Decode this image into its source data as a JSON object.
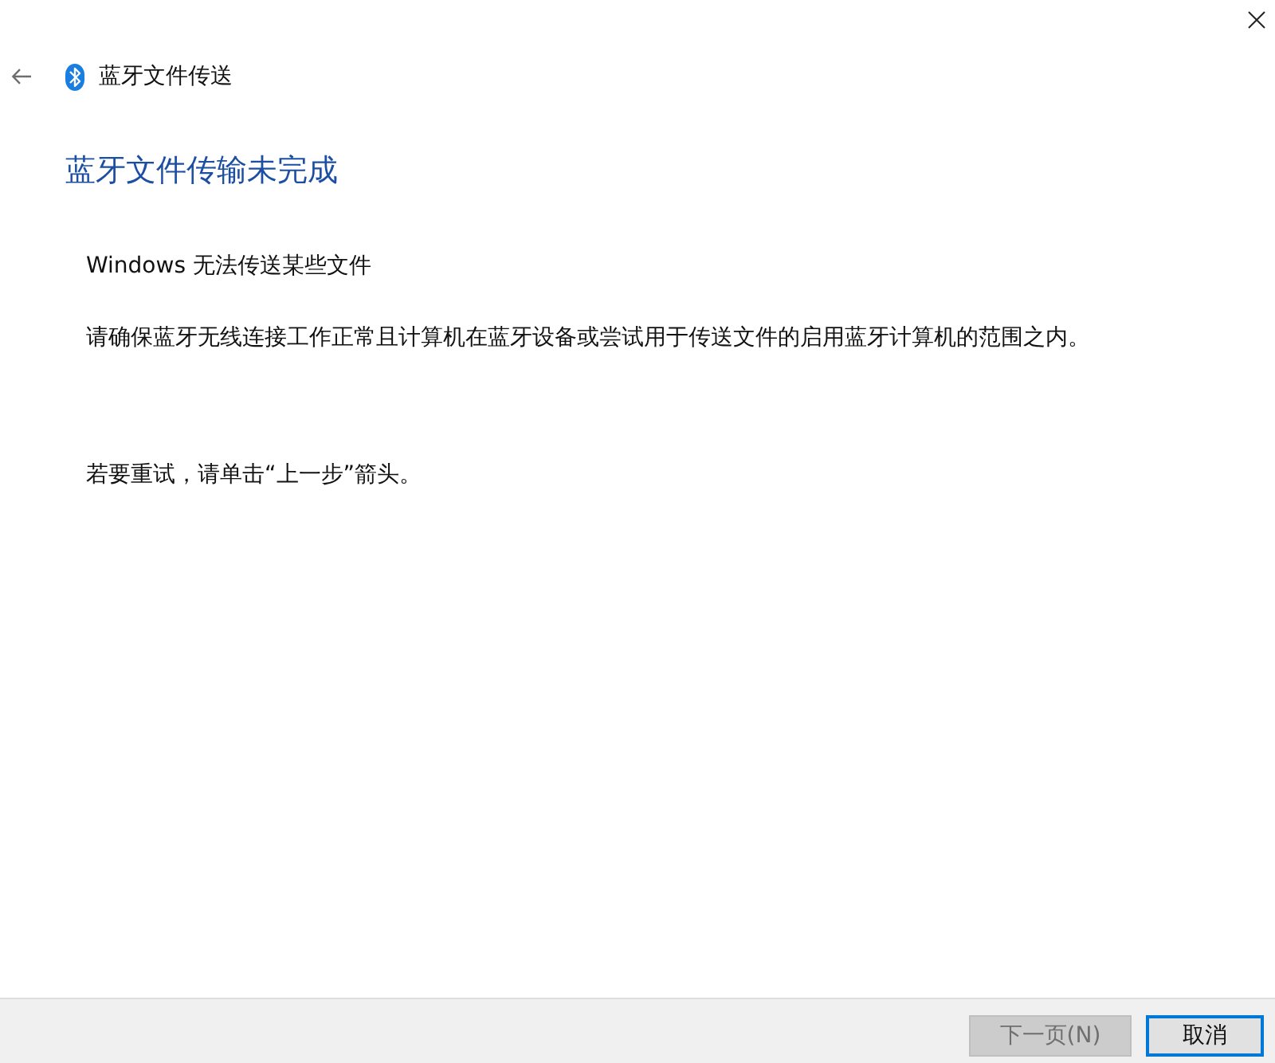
{
  "window": {
    "title": "蓝牙文件传送"
  },
  "heading": "蓝牙文件传输未完成",
  "message": "Windows 无法传送某些文件",
  "details": "请确保蓝牙无线连接工作正常且计算机在蓝牙设备或尝试用于传送文件的启用蓝牙计算机的范围之内。",
  "retry_hint": "若要重试，请单击“上一步”箭头。",
  "buttons": [
    {
      "label": "下一页(N)",
      "disabled": true,
      "default": false
    },
    {
      "label": "取消",
      "disabled": false,
      "default": true
    }
  ]
}
